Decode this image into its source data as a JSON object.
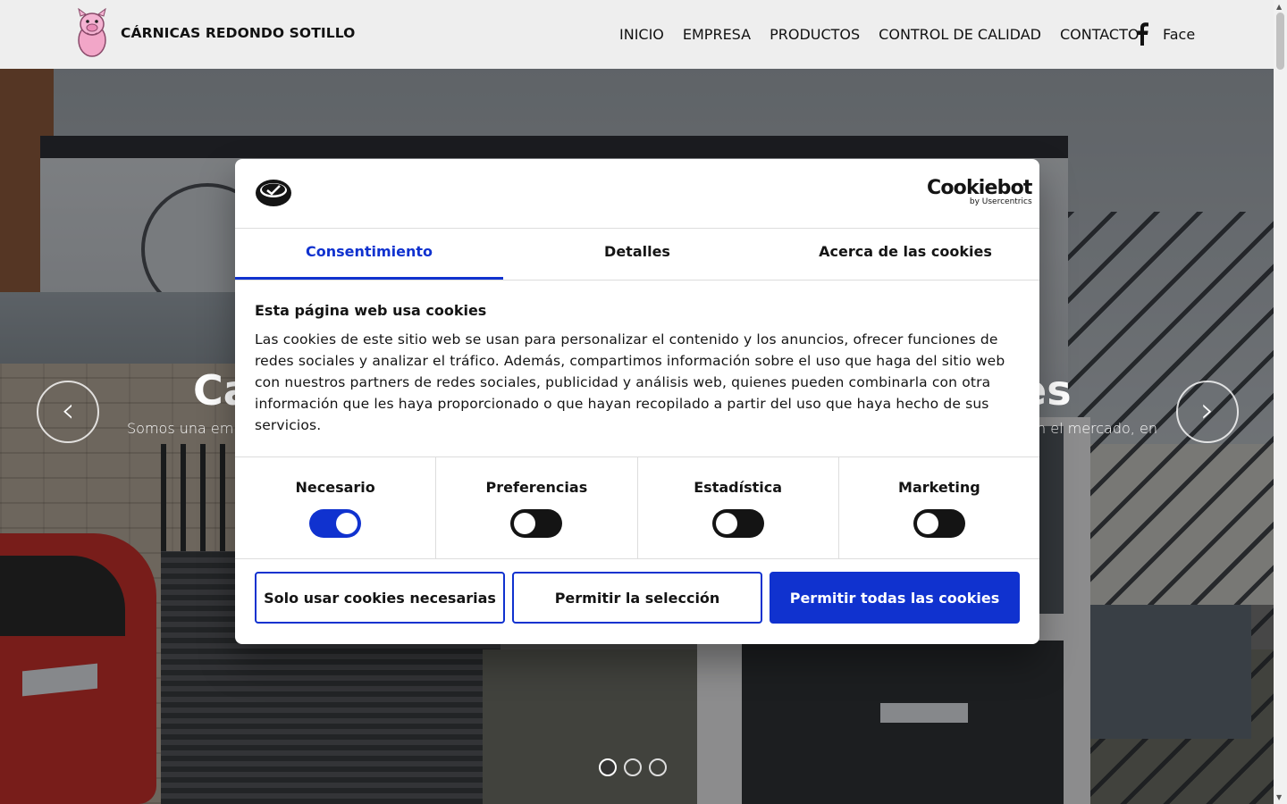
{
  "header": {
    "site_name": "CÁRNICAS REDONDO SOTILLO",
    "logo_icon": "pig-mascot-icon",
    "nav": [
      "INICIO",
      "EMPRESA",
      "PRODUCTOS",
      "CONTROL DE CALIDAD",
      "CONTACTO"
    ],
    "facebook_icon": "facebook-icon",
    "facebook_label": "Face"
  },
  "hero": {
    "title_start": "Ca",
    "title_end": "es",
    "text_left": "Somos una empr",
    "text_right": "n el mercado, en",
    "prev_icon": "chevron-left-icon",
    "next_icon": "chevron-right-icon",
    "prev_glyph": "‹",
    "next_glyph": "›",
    "slides": 3,
    "active_slide": 1
  },
  "cookie_dialog": {
    "brand": "Cookiebot",
    "brand_sub": "by Usercentrics",
    "tabs": [
      "Consentimiento",
      "Detalles",
      "Acerca de las cookies"
    ],
    "active_tab": 0,
    "title": "Esta página web usa cookies",
    "text": "Las cookies de este sitio web se usan para personalizar el contenido y los anuncios, ofrecer funciones de redes sociales y analizar el tráfico. Además, compartimos información sobre el uso que haga del sitio web con nuestros partners de redes sociales, publicidad y análisis web, quienes pueden combinarla con otra información que les haya proporcionado o que hayan recopilado a partir del uso que haya hecho de sus servicios.",
    "toggles": [
      {
        "label": "Necesario",
        "on": true
      },
      {
        "label": "Preferencias",
        "on": false
      },
      {
        "label": "Estadística",
        "on": false
      },
      {
        "label": "Marketing",
        "on": false
      }
    ],
    "buttons": {
      "necessary_only": "Solo usar cookies necesarias",
      "allow_selection": "Permitir la selección",
      "allow_all": "Permitir todas las cookies"
    },
    "accent_color": "#1032cf"
  }
}
